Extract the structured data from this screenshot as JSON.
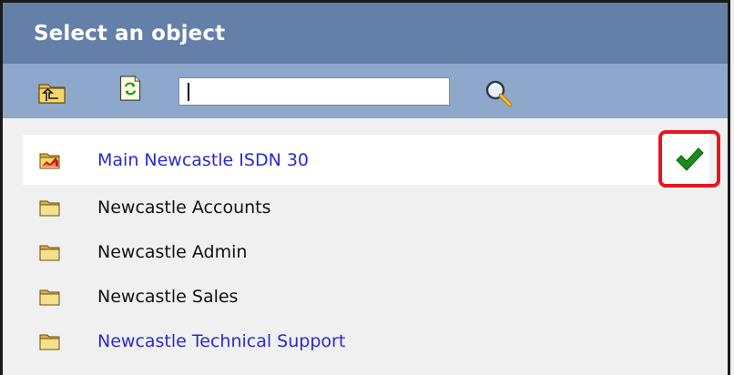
{
  "window": {
    "title": "Select an object"
  },
  "toolbar": {
    "up_icon": "folder-up-icon",
    "refresh_icon": "refresh-icon",
    "search_value": "",
    "search_icon": "magnifier-icon"
  },
  "list": {
    "items": [
      {
        "label": "Main Newcastle ISDN 30",
        "icon": "chart-folder-icon",
        "selected": true,
        "link": true
      },
      {
        "label": "Newcastle Accounts",
        "icon": "folder-icon",
        "selected": false,
        "link": false
      },
      {
        "label": "Newcastle Admin",
        "icon": "folder-icon",
        "selected": false,
        "link": false
      },
      {
        "label": "Newcastle Sales",
        "icon": "folder-icon",
        "selected": false,
        "link": false
      },
      {
        "label": "Newcastle Technical Support",
        "icon": "folder-icon",
        "selected": false,
        "link": true
      }
    ],
    "selected_mark_icon": "checkmark-icon"
  },
  "colors": {
    "titlebar": "#6480a8",
    "toolbar": "#8ea8cc",
    "link": "#2a2ad0",
    "highlight_border": "#e8141e",
    "checkmark": "#1a8c1a"
  }
}
